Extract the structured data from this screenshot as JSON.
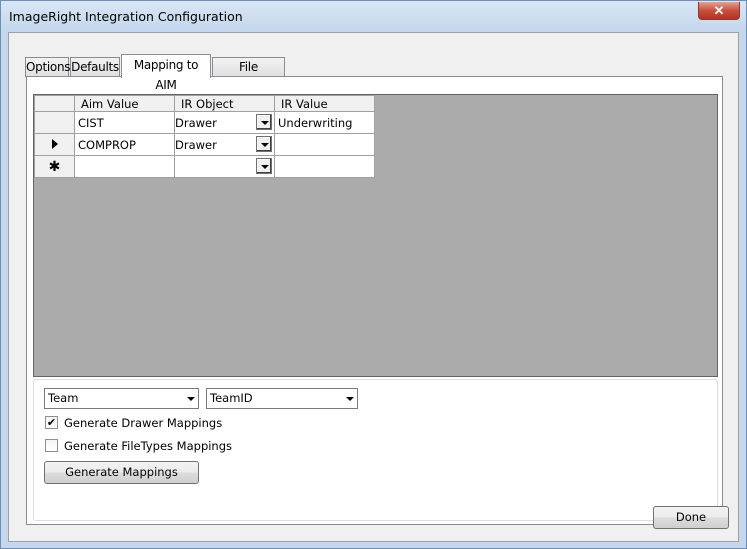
{
  "window": {
    "title": "ImageRight Integration Configuration",
    "close_glyph": "✕"
  },
  "tabs": [
    {
      "label": "Options",
      "active": false
    },
    {
      "label": "Defaults",
      "active": false
    },
    {
      "label": "Mapping to AIM",
      "active": true
    },
    {
      "label": "File Attributes",
      "active": false
    }
  ],
  "grid": {
    "columns": [
      "Aim Value",
      "IR Object",
      "IR Value"
    ],
    "rows": [
      {
        "indicator": "",
        "aim_value": "CIST",
        "ir_object": "Drawer",
        "ir_value": "Underwriting"
      },
      {
        "indicator": "current-row-arrow",
        "aim_value": "COMPROP",
        "ir_object": "Drawer",
        "ir_value": ""
      },
      {
        "indicator": "new-row",
        "aim_value": "",
        "ir_object": "",
        "ir_value": ""
      }
    ],
    "new_row_glyph": "✱"
  },
  "options": {
    "combo1_value": "Team",
    "combo2_value": "TeamID",
    "generate_drawer_label": "Generate Drawer Mappings",
    "generate_drawer_checked": true,
    "generate_filetypes_label": "Generate FileTypes Mappings",
    "generate_filetypes_checked": false,
    "generate_button_label": "Generate Mappings",
    "check_glyph": "✔"
  },
  "footer": {
    "done_label": "Done"
  }
}
